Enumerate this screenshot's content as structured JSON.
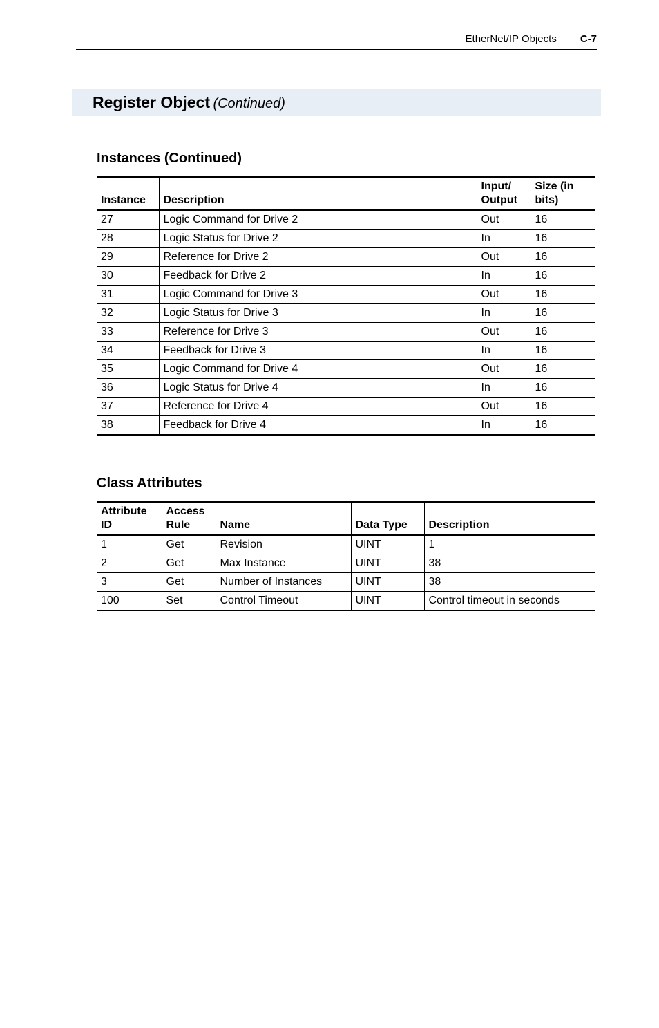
{
  "running_head": {
    "chapter": "EtherNet/IP Objects",
    "page": "C-7"
  },
  "section": {
    "title": "Register Object",
    "cont": "(Continued)"
  },
  "instances": {
    "heading": "Instances (Continued)",
    "headers": {
      "instance": "Instance",
      "description": "Description",
      "io": "Input/\nOutput",
      "size": "Size\n(in bits)"
    },
    "rows": [
      {
        "instance": "27",
        "description": "Logic Command for Drive 2",
        "io": "Out",
        "size": "16"
      },
      {
        "instance": "28",
        "description": "Logic Status for Drive 2",
        "io": "In",
        "size": "16"
      },
      {
        "instance": "29",
        "description": "Reference for Drive 2",
        "io": "Out",
        "size": "16"
      },
      {
        "instance": "30",
        "description": "Feedback for Drive 2",
        "io": "In",
        "size": "16"
      },
      {
        "instance": "31",
        "description": "Logic Command for Drive 3",
        "io": "Out",
        "size": "16"
      },
      {
        "instance": "32",
        "description": "Logic Status for Drive 3",
        "io": "In",
        "size": "16"
      },
      {
        "instance": "33",
        "description": "Reference for Drive 3",
        "io": "Out",
        "size": "16"
      },
      {
        "instance": "34",
        "description": "Feedback for Drive 3",
        "io": "In",
        "size": "16"
      },
      {
        "instance": "35",
        "description": "Logic Command for Drive 4",
        "io": "Out",
        "size": "16"
      },
      {
        "instance": "36",
        "description": "Logic Status for Drive 4",
        "io": "In",
        "size": "16"
      },
      {
        "instance": "37",
        "description": "Reference for Drive 4",
        "io": "Out",
        "size": "16"
      },
      {
        "instance": "38",
        "description": "Feedback for Drive 4",
        "io": "In",
        "size": "16"
      }
    ]
  },
  "class_attributes": {
    "heading": "Class Attributes",
    "headers": {
      "id": "Attribute\nID",
      "access": "Access\nRule",
      "name": "Name",
      "datatype": "Data Type",
      "description": "Description"
    },
    "rows": [
      {
        "id": "1",
        "access": "Get",
        "name": "Revision",
        "datatype": "UINT",
        "description": "1"
      },
      {
        "id": "2",
        "access": "Get",
        "name": "Max Instance",
        "datatype": "UINT",
        "description": "38"
      },
      {
        "id": "3",
        "access": "Get",
        "name": "Number of Instances",
        "datatype": "UINT",
        "description": "38"
      },
      {
        "id": "100",
        "access": "Set",
        "name": "Control Timeout",
        "datatype": "UINT",
        "description": "Control timeout in seconds"
      }
    ]
  }
}
